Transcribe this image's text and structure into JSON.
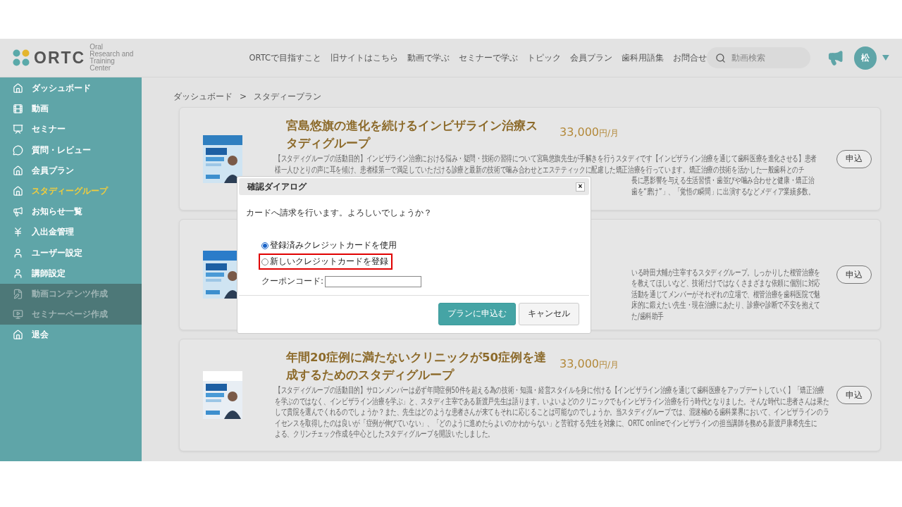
{
  "header": {
    "logo": {
      "name": "ORTC",
      "tagline": [
        "Oral",
        "Research and",
        "Training",
        "Center"
      ]
    },
    "nav": [
      "ORTCで目指すこと",
      "旧サイトはこちら",
      "動画で学ぶ",
      "セミナーで学ぶ",
      "トピック",
      "会員プラン",
      "歯科用語集",
      "お問合せ"
    ],
    "search": {
      "placeholder": "動画検索"
    },
    "avatar": "松"
  },
  "sidebar": {
    "items": [
      {
        "label": "ダッシュボード",
        "selected": false,
        "disabled": false
      },
      {
        "label": "動画",
        "selected": false,
        "disabled": false
      },
      {
        "label": "セミナー",
        "selected": false,
        "disabled": false
      },
      {
        "label": "質問・レビュー",
        "selected": false,
        "disabled": false
      },
      {
        "label": "会員プラン",
        "selected": false,
        "disabled": false
      },
      {
        "label": "スタディーグループ",
        "selected": true,
        "disabled": false
      },
      {
        "label": "お知らせ一覧",
        "selected": false,
        "disabled": false
      },
      {
        "label": "入出金管理",
        "selected": false,
        "disabled": false
      },
      {
        "label": "ユーザー設定",
        "selected": false,
        "disabled": false
      },
      {
        "label": "講師設定",
        "selected": false,
        "disabled": false
      },
      {
        "label": "動画コンテンツ作成",
        "selected": false,
        "disabled": true
      },
      {
        "label": "セミナーページ作成",
        "selected": false,
        "disabled": true
      },
      {
        "label": "退会",
        "selected": false,
        "disabled": false
      }
    ]
  },
  "breadcrumb": {
    "items": [
      "ダッシュボード",
      "スタディープラン"
    ],
    "separator": ">"
  },
  "plans": [
    {
      "title": "宮島悠旗の進化を続けるインビザライン治療スタディグループ",
      "price": "33,000",
      "unit": "円/月",
      "image": {
        "kind": "picture"
      },
      "button": "申込",
      "description": [
        {
          "kind": "full",
          "text": "【スタディグループの活動目的】インビザライン治療における悩み・疑問・技術の習得について宮島悠旗先生が手解きを行うスタディです【インビザライン治療を通じて歯科医療を進化させる】患者"
        },
        {
          "kind": "full",
          "text": "様一人ひとりの声に耳を傾け、患者様第一で満足していただける診療と最新の技術で噛み合わせとエステティックに配慮した矯正治療を行っています。矯正治療の技術を活かした一般歯科とのチ"
        },
        {
          "kind": "tail",
          "text": "長に悪影響を与える生活習慣・歯並びや噛み合わせと健康・矯正治"
        },
        {
          "kind": "tail",
          "text": "歯を“磨け”」、「覚悟の瞬間」に出演するなどメディア業績多数。"
        }
      ]
    },
    {
      "image": {
        "kind": "picture"
      },
      "button": "申込",
      "description": [
        {
          "kind": "tail",
          "text": "いる時田大輔が主宰するスタディグループ。しっかりした根管治療を"
        },
        {
          "kind": "tail",
          "text": "を教えてほしいなど、技術だけではなくさまざまな依頼に個別に対応"
        },
        {
          "kind": "tail",
          "text": "活動を通じてメンバーがそれぞれの立場で、根管治療を歯科医院で魅"
        },
        {
          "kind": "tail",
          "text": "床的に鍛えたい先生・現在治療にあたり、診療や診断で不安を抱えて"
        },
        {
          "kind": "tail",
          "text": "た/歯科助手"
        }
      ]
    },
    {
      "title": "年間20症例に満たないクリニックが50症例を達成するためのスタディグループ",
      "price": "33,000",
      "unit": "円/月",
      "image": {
        "kind": "picture"
      },
      "button": "申込",
      "description": [
        {
          "kind": "full",
          "text": "【スタディグループの活動目的】サロンメンバーは必ず年間症例50件を超える為の技術・知識・経営スタイルを身に付ける【インビザライン治療を通じて歯科医療をアップデートしていく】「矯正治療"
        },
        {
          "kind": "full",
          "text": "を学ぶのではなく、インビザライン治療を学ぶ」と、スタディ主宰である新渡戸先生は語ります。いよいよどのクリニックでもインビザライン治療を行う時代となりました。そんな時代に患者さんは果た"
        },
        {
          "kind": "full",
          "text": "して貴院を選んでくれるのでしょうか？また、先生はどのような患者さんが来てもそれに応じることは可能なのでしょうか。当スタディグループでは、混迷極める歯科業界において、インビザラインのラ"
        },
        {
          "kind": "full",
          "text": "イセンスを取得したのは良いが「症例が伸びていない」、「どのように進めたらよいのかわからない」と苦戦する先生を対象に、ORTC onlineでインビザラインの担当講師を務める新渡戸康希先生に"
        },
        {
          "kind": "full",
          "text": "よる、クリンチェック作成を中心としたスタディグループを開設いたしました。"
        }
      ]
    }
  ],
  "dialog": {
    "title": "確認ダイアログ",
    "close": "×",
    "message": "カードへ請求を行います。よろしいでしょうか？",
    "options": [
      {
        "label": "登録済みクレジットカードを使用",
        "selected": true,
        "highlighted": false
      },
      {
        "label": "新しいクレジットカードを登録",
        "selected": false,
        "highlighted": true
      }
    ],
    "coupon": {
      "label": "クーポンコード:"
    },
    "buttons": [
      {
        "label": "プランに申込む",
        "kind": "primary"
      },
      {
        "label": "キャンセル",
        "kind": "secondary"
      }
    ]
  }
}
